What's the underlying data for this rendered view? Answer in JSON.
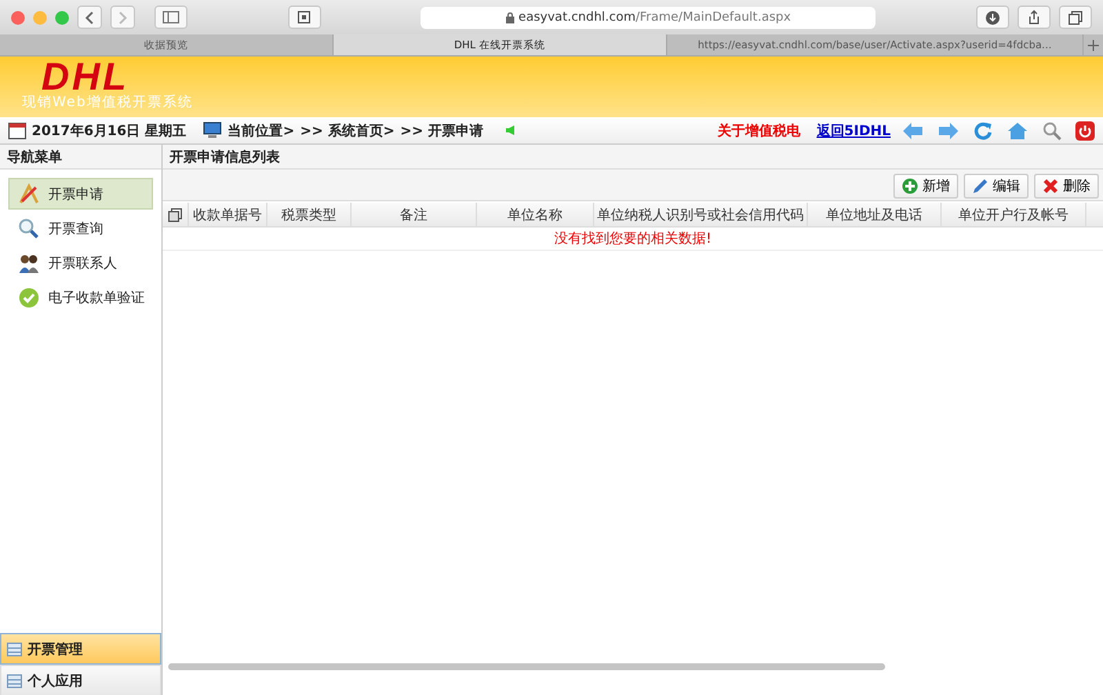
{
  "browser": {
    "url_host": "easyvat.cndhl.com",
    "url_path": "/Frame/MainDefault.aspx",
    "tabs": [
      {
        "label": "收据预览",
        "selected": false
      },
      {
        "label": "DHL 在线开票系统",
        "selected": true
      },
      {
        "label": "https://easyvat.cndhl.com/base/user/Activate.aspx?userid=4fdcba...",
        "selected": false
      }
    ]
  },
  "banner": {
    "logo": "DHL",
    "subtitle": "现销Web增值税开票系统"
  },
  "infobar": {
    "date": "2017年6月16日 星期五",
    "breadcrumb": [
      "当前位置>",
      ">> 系统首页>",
      ">> 开票申请"
    ],
    "about_link": "关于增值税电",
    "return_link": "返回5IDHL"
  },
  "sidebar": {
    "title": "导航菜单",
    "items": [
      {
        "label": "开票申请",
        "kind": "apply",
        "selected": true
      },
      {
        "label": "开票查询",
        "kind": "search",
        "selected": false
      },
      {
        "label": "开票联系人",
        "kind": "contacts",
        "selected": false
      },
      {
        "label": "电子收款单验证",
        "kind": "verify",
        "selected": false
      }
    ],
    "sections": [
      {
        "label": "开票管理",
        "selected": true
      },
      {
        "label": "个人应用",
        "selected": false
      }
    ]
  },
  "main": {
    "title": "开票申请信息列表",
    "buttons": [
      {
        "label": "新增",
        "kind": "add"
      },
      {
        "label": "编辑",
        "kind": "edit"
      },
      {
        "label": "删除",
        "kind": "delete"
      }
    ],
    "columns": [
      "收款单据号",
      "税票类型",
      "备注",
      "单位名称",
      "单位纳税人识别号或社会信用代码",
      "单位地址及电话",
      "单位开户行及帐号"
    ],
    "empty_message": "没有找到您要的相关数据!"
  }
}
